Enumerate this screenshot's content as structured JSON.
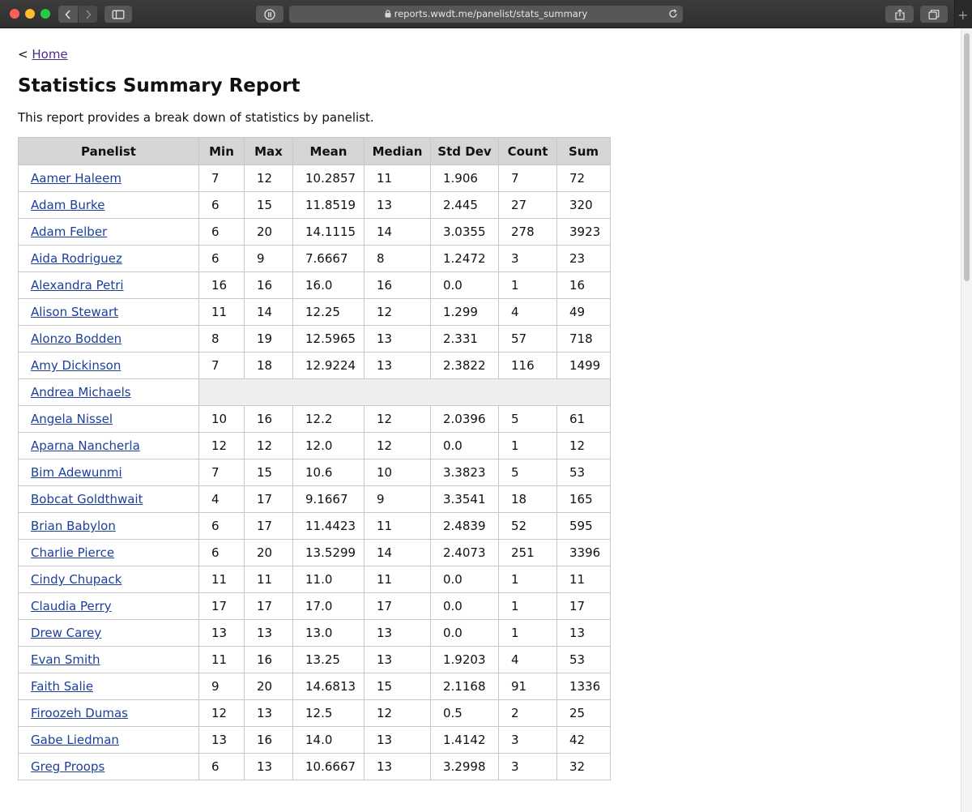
{
  "browser": {
    "url": "reports.wwdt.me/panelist/stats_summary"
  },
  "page": {
    "breadcrumb_prefix": "<",
    "home_link": "Home",
    "title": "Statistics Summary Report",
    "intro": "This report provides a break down of statistics by panelist."
  },
  "table": {
    "headers": [
      "Panelist",
      "Min",
      "Max",
      "Mean",
      "Median",
      "Std Dev",
      "Count",
      "Sum"
    ],
    "rows": [
      {
        "name": "Aamer Haleem",
        "values": [
          "7",
          "12",
          "10.2857",
          "11",
          "1.906",
          "7",
          "72"
        ]
      },
      {
        "name": "Adam Burke",
        "values": [
          "6",
          "15",
          "11.8519",
          "13",
          "2.445",
          "27",
          "320"
        ]
      },
      {
        "name": "Adam Felber",
        "values": [
          "6",
          "20",
          "14.1115",
          "14",
          "3.0355",
          "278",
          "3923"
        ]
      },
      {
        "name": "Aida Rodriguez",
        "values": [
          "6",
          "9",
          "7.6667",
          "8",
          "1.2472",
          "3",
          "23"
        ]
      },
      {
        "name": "Alexandra Petri",
        "values": [
          "16",
          "16",
          "16.0",
          "16",
          "0.0",
          "1",
          "16"
        ]
      },
      {
        "name": "Alison Stewart",
        "values": [
          "11",
          "14",
          "12.25",
          "12",
          "1.299",
          "4",
          "49"
        ]
      },
      {
        "name": "Alonzo Bodden",
        "values": [
          "8",
          "19",
          "12.5965",
          "13",
          "2.331",
          "57",
          "718"
        ]
      },
      {
        "name": "Amy Dickinson",
        "values": [
          "7",
          "18",
          "12.9224",
          "13",
          "2.3822",
          "116",
          "1499"
        ]
      },
      {
        "name": "Andrea Michaels",
        "values": []
      },
      {
        "name": "Angela Nissel",
        "values": [
          "10",
          "16",
          "12.2",
          "12",
          "2.0396",
          "5",
          "61"
        ]
      },
      {
        "name": "Aparna Nancherla",
        "values": [
          "12",
          "12",
          "12.0",
          "12",
          "0.0",
          "1",
          "12"
        ]
      },
      {
        "name": "Bim Adewunmi",
        "values": [
          "7",
          "15",
          "10.6",
          "10",
          "3.3823",
          "5",
          "53"
        ]
      },
      {
        "name": "Bobcat Goldthwait",
        "values": [
          "4",
          "17",
          "9.1667",
          "9",
          "3.3541",
          "18",
          "165"
        ]
      },
      {
        "name": "Brian Babylon",
        "values": [
          "6",
          "17",
          "11.4423",
          "11",
          "2.4839",
          "52",
          "595"
        ]
      },
      {
        "name": "Charlie Pierce",
        "values": [
          "6",
          "20",
          "13.5299",
          "14",
          "2.4073",
          "251",
          "3396"
        ]
      },
      {
        "name": "Cindy Chupack",
        "values": [
          "11",
          "11",
          "11.0",
          "11",
          "0.0",
          "1",
          "11"
        ]
      },
      {
        "name": "Claudia Perry",
        "values": [
          "17",
          "17",
          "17.0",
          "17",
          "0.0",
          "1",
          "17"
        ]
      },
      {
        "name": "Drew Carey",
        "values": [
          "13",
          "13",
          "13.0",
          "13",
          "0.0",
          "1",
          "13"
        ]
      },
      {
        "name": "Evan Smith",
        "values": [
          "11",
          "16",
          "13.25",
          "13",
          "1.9203",
          "4",
          "53"
        ]
      },
      {
        "name": "Faith Salie",
        "values": [
          "9",
          "20",
          "14.6813",
          "15",
          "2.1168",
          "91",
          "1336"
        ]
      },
      {
        "name": "Firoozeh Dumas",
        "values": [
          "12",
          "13",
          "12.5",
          "12",
          "0.5",
          "2",
          "25"
        ]
      },
      {
        "name": "Gabe Liedman",
        "values": [
          "13",
          "16",
          "14.0",
          "13",
          "1.4142",
          "3",
          "42"
        ]
      },
      {
        "name": "Greg Proops",
        "values": [
          "6",
          "13",
          "10.6667",
          "13",
          "3.2998",
          "3",
          "32"
        ]
      }
    ]
  },
  "colors": {
    "header_bg": "#d6d6d6",
    "link": "#1d3f9c",
    "visited_link": "#4b2b8c",
    "empty_row_bg": "#eeeeee"
  }
}
